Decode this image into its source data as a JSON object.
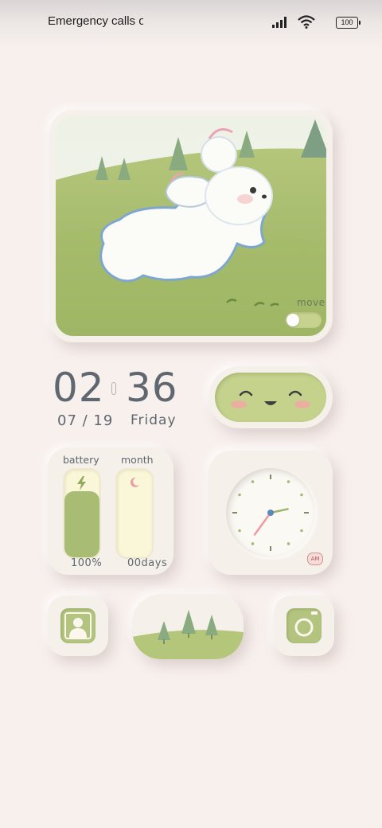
{
  "status_bar": {
    "carrier_text": "Emergency calls o",
    "battery_level": "100",
    "signal_icon": "signal-bars-icon",
    "wifi_icon": "wifi-icon"
  },
  "picture_widget": {
    "toggle_label": "move",
    "toggle_state": "off"
  },
  "clock": {
    "hours": "02",
    "minutes": "36",
    "date": "07 / 19",
    "weekday": "Friday"
  },
  "stats_widget": {
    "battery_label": "battery",
    "battery_value": "100%",
    "battery_fill": 0.75,
    "month_label": "month",
    "month_value": "00days",
    "month_fill": 0
  },
  "analog_clock": {
    "hour": 2,
    "minute": 36,
    "period": "AM"
  },
  "apps": [
    {
      "name": "contacts",
      "icon": "person-icon"
    },
    {
      "name": "scenery",
      "icon": "trees-icon"
    },
    {
      "name": "camera",
      "icon": "camera-icon"
    }
  ],
  "colors": {
    "background": "#f8f0ed",
    "accent_green": "#b2c47e",
    "text_gray": "#5f6770"
  }
}
